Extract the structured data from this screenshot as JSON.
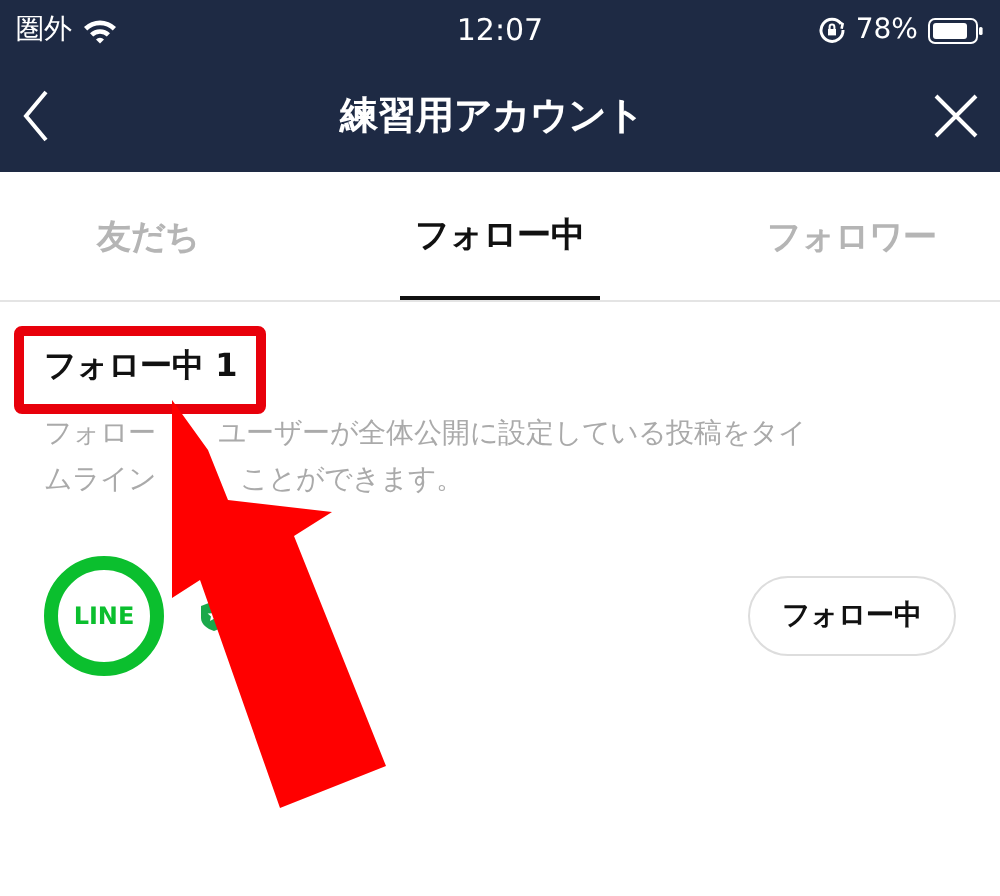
{
  "status_bar": {
    "carrier": "圏外",
    "time": "12:07",
    "battery": "78%"
  },
  "header": {
    "title": "練習用アカウント"
  },
  "tabs": [
    {
      "label": "友だち",
      "selected": false
    },
    {
      "label": "フォロー中",
      "selected": true
    },
    {
      "label": "フォロワー",
      "selected": false
    }
  ],
  "section": {
    "heading": "フォロー中 1",
    "description_lines": [
      [
        "フォロー",
        "ユーザーが全体公開に設定している投稿をタイ"
      ],
      [
        "ムライン",
        "ことができます。"
      ]
    ]
  },
  "accounts": [
    {
      "logo_text": "LINE",
      "verified": true,
      "button": "フォロー中"
    }
  ]
}
